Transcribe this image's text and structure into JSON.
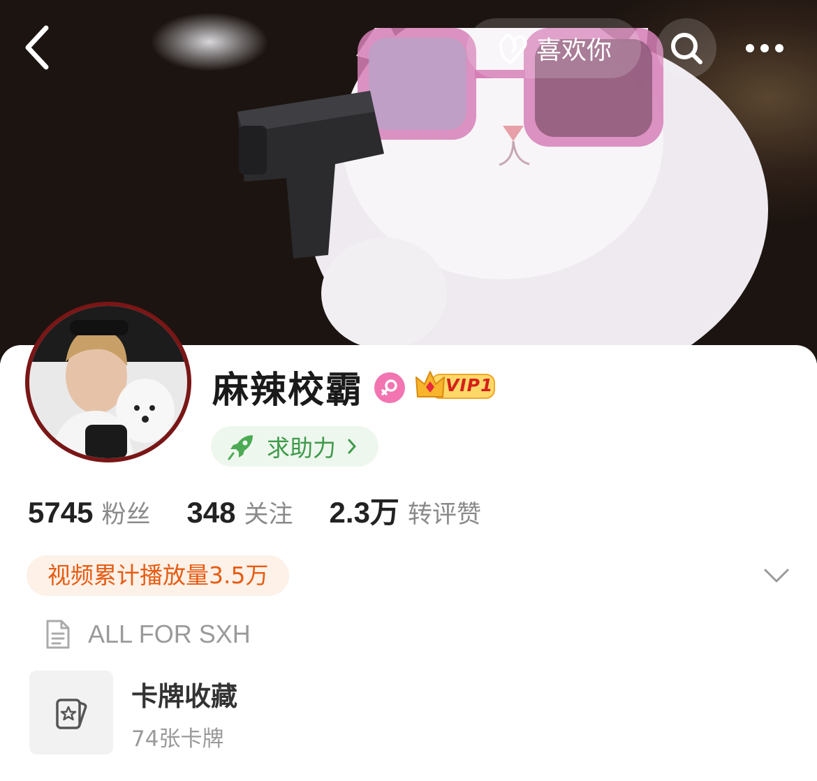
{
  "header": {
    "like_label": "喜欢你"
  },
  "profile": {
    "username": "麻辣校霸",
    "vip_label": "VIP1",
    "help_label": "求助力",
    "bio": "ALL FOR SXH"
  },
  "stats": [
    {
      "value": "5745",
      "label": "粉丝"
    },
    {
      "value": "348",
      "label": "关注"
    },
    {
      "value": "2.3万",
      "label": "转评赞"
    }
  ],
  "play_tag": "视频累计播放量3.5万",
  "card_collection": {
    "title": "卡牌收藏",
    "subtitle": "74张卡牌"
  },
  "icons": {
    "back": "chevron-left-icon",
    "like": "hand-heart-icon",
    "search": "search-icon",
    "more": "more-dots-icon",
    "gender": "female-icon",
    "vip": "crown-icon",
    "help": "rocket-icon",
    "expand": "chevron-down-icon",
    "bio": "document-icon",
    "cards": "card-star-icon"
  },
  "colors": {
    "accent_orange": "#e65c12",
    "help_green": "#3f9a4a",
    "gender_pink": "#f275b2",
    "vip_red": "#d4201a"
  }
}
